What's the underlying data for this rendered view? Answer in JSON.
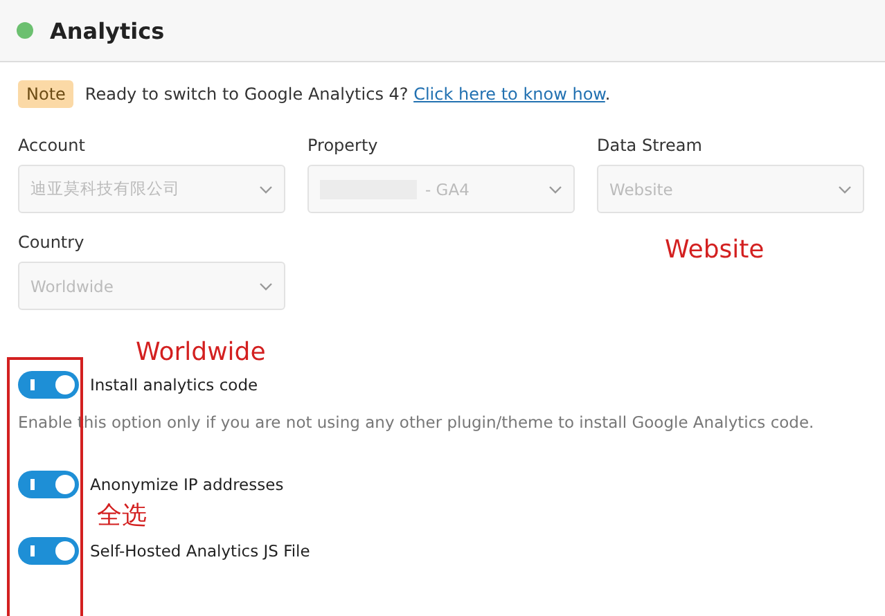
{
  "header": {
    "title": "Analytics",
    "active": true
  },
  "notice": {
    "badge": "Note",
    "text": "Ready to switch to Google Analytics 4?",
    "link": "Click here to know how",
    "after": "."
  },
  "selects": [
    {
      "label": "Account",
      "value": "迪亚莫科技有限公司",
      "disabled": true
    },
    {
      "label": "Property",
      "value": "- GA4",
      "redacted": true,
      "disabled": true
    },
    {
      "label": "Data Stream",
      "value": "Website",
      "disabled": true
    },
    {
      "label": "Country",
      "value": "Worldwide",
      "disabled": true
    }
  ],
  "options": [
    {
      "label": "Install analytics code",
      "on": true,
      "help": "Enable this option only if you are not using any other plugin/theme to install Google Analytics code."
    },
    {
      "label": "Anonymize IP addresses",
      "on": true
    },
    {
      "label": "Self-Hosted Analytics JS File",
      "on": true
    }
  ],
  "annotations": [
    {
      "text": "Website"
    },
    {
      "text": "Worldwide"
    },
    {
      "text": "全选"
    }
  ]
}
